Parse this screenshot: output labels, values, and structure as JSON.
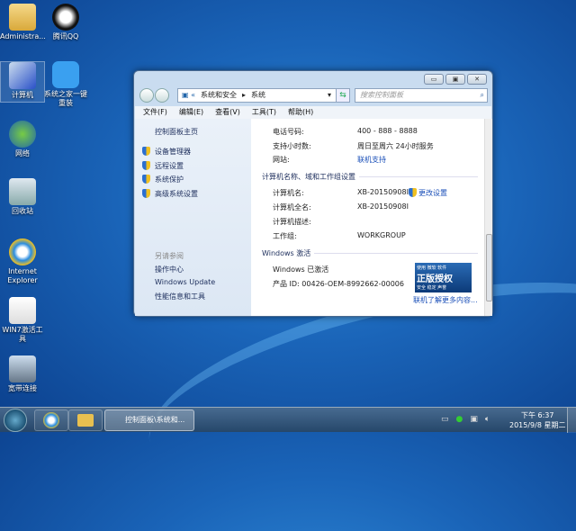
{
  "desktop": {
    "icons": [
      {
        "label": "Administra...",
        "icon": "user-folder-icon"
      },
      {
        "label": "腾讯QQ",
        "icon": "qq-penguin-icon"
      },
      {
        "label": "计算机",
        "icon": "computer-icon"
      },
      {
        "label": "系统之家一键重装",
        "icon": "reinstall-icon"
      },
      {
        "label": "网络",
        "icon": "network-icon"
      },
      {
        "label": "回收站",
        "icon": "recycle-bin-icon"
      },
      {
        "label": "Internet Explorer",
        "icon": "ie-icon"
      },
      {
        "label": "WIN7激活工具",
        "icon": "activation-tool-icon"
      },
      {
        "label": "宽带连接",
        "icon": "broadband-icon"
      }
    ]
  },
  "window": {
    "breadcrumb": [
      "系统和安全",
      "系统"
    ],
    "search_placeholder": "搜索控制面板",
    "menu": [
      "文件(F)",
      "编辑(E)",
      "查看(V)",
      "工具(T)",
      "帮助(H)"
    ],
    "left": {
      "home": "控制面板主页",
      "tasks": [
        "设备管理器",
        "远程设置",
        "系统保护",
        "高级系统设置"
      ],
      "see_also_title": "另请参阅",
      "see_also": [
        "操作中心",
        "Windows Update",
        "性能信息和工具"
      ]
    },
    "support": {
      "phone_label": "电话号码:",
      "phone": "400 - 888 - 8888",
      "hours_label": "支持小时数:",
      "hours": "周日至周六  24小时服务",
      "site_label": "网站:",
      "site": "联机支持"
    },
    "computer": {
      "section": "计算机名称、域和工作组设置",
      "name_label": "计算机名:",
      "name": "XB-20150908I",
      "change": "更改设置",
      "full_label": "计算机全名:",
      "full": "XB-20150908I",
      "desc_label": "计算机描述:",
      "wg_label": "工作组:",
      "wg": "WORKGROUP"
    },
    "activation": {
      "section": "Windows 激活",
      "status": "Windows 已激活",
      "pid": "产品 ID: 00426-OEM-8992662-00006",
      "badge_top": "使用 微软 软件",
      "badge_main": "正版授权",
      "badge_bottom": "安全 稳定 声誉",
      "more": "联机了解更多内容..."
    }
  },
  "taskbar": {
    "task": "控制面板\\系统和...",
    "time": "下午 6:37",
    "date": "2015/9/8 星期二"
  }
}
